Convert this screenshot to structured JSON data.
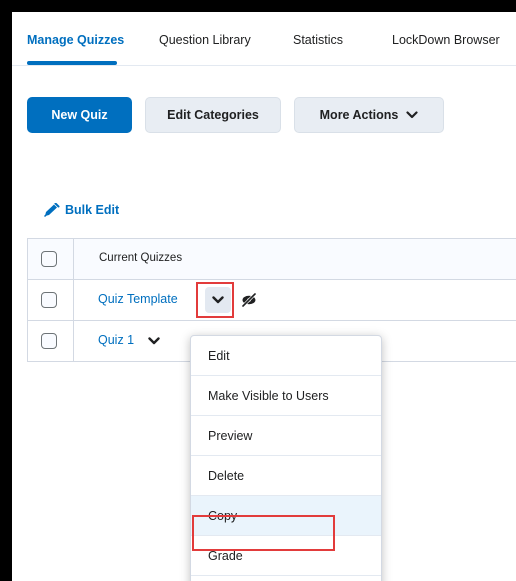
{
  "tabs": [
    {
      "label": "Manage Quizzes",
      "active": true
    },
    {
      "label": "Question Library"
    },
    {
      "label": "Statistics"
    },
    {
      "label": "LockDown Browser"
    }
  ],
  "toolbar": {
    "new_quiz": "New Quiz",
    "edit_categories": "Edit Categories",
    "more_actions": "More Actions"
  },
  "bulk_edit": "Bulk Edit",
  "table": {
    "header": "Current Quizzes",
    "rows": [
      {
        "title": "Quiz Template",
        "hidden": true
      },
      {
        "title": "Quiz 1"
      }
    ]
  },
  "menu": {
    "items": [
      "Edit",
      "Make Visible to Users",
      "Preview",
      "Delete",
      "Copy",
      "Grade"
    ],
    "selected": "Copy"
  },
  "colors": {
    "accent": "#006fbf",
    "highlight_box": "#e23b3b"
  },
  "icons": {
    "bulk_edit": "pencil-icon",
    "chevron": "chevron-down-icon",
    "visibility": "eye-slash-icon"
  }
}
